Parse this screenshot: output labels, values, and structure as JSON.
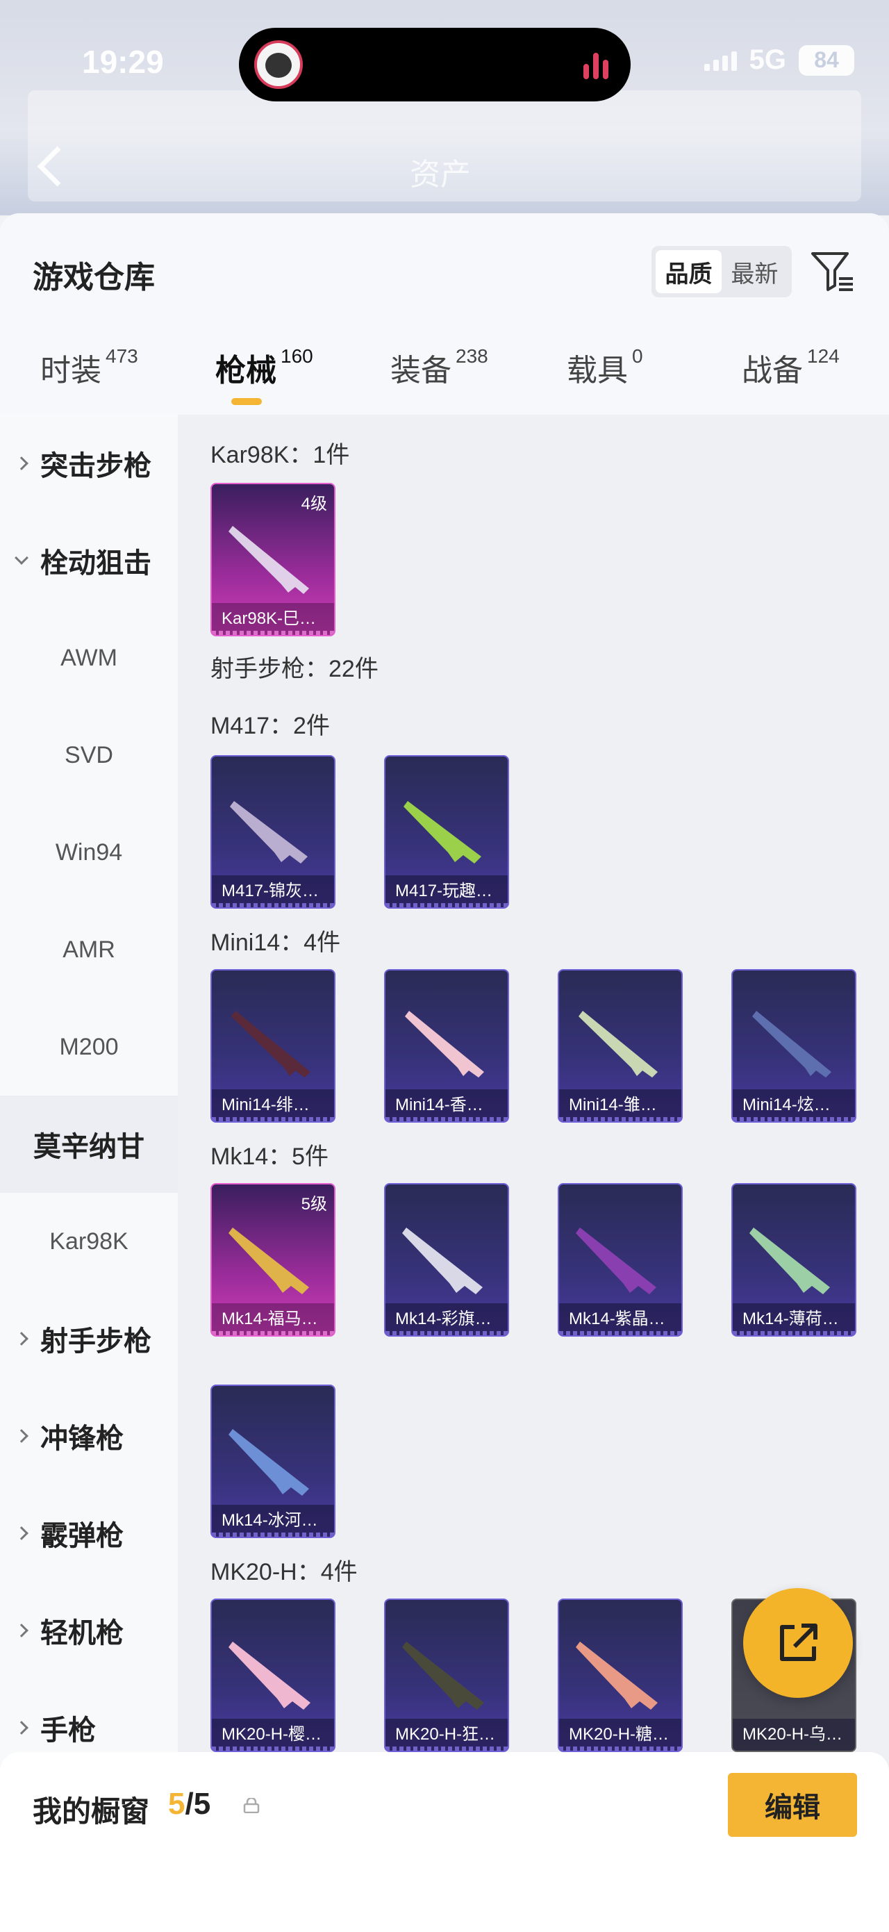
{
  "status_bar": {
    "time": "19:29",
    "network": "5G",
    "battery": "84"
  },
  "background_header": {
    "title": "资产"
  },
  "sheet": {
    "title": "游戏仓库",
    "sort": {
      "quality": "品质",
      "latest": "最新"
    },
    "tabs": [
      {
        "label": "时装",
        "count": "473"
      },
      {
        "label": "枪械",
        "count": "160"
      },
      {
        "label": "装备",
        "count": "238"
      },
      {
        "label": "载具",
        "count": "0"
      },
      {
        "label": "战备",
        "count": "124"
      }
    ]
  },
  "sidebar": {
    "items": [
      {
        "label": "突击步枪"
      },
      {
        "label": "栓动狙击"
      },
      {
        "label": "AWM"
      },
      {
        "label": "SVD"
      },
      {
        "label": "Win94"
      },
      {
        "label": "AMR"
      },
      {
        "label": "M200"
      },
      {
        "label": "莫辛纳甘"
      },
      {
        "label": "Kar98K"
      },
      {
        "label": "射手步枪"
      },
      {
        "label": "冲锋枪"
      },
      {
        "label": "霰弹枪"
      },
      {
        "label": "轻机枪"
      },
      {
        "label": "手枪"
      }
    ]
  },
  "content": {
    "groups": [
      {
        "title": "Kar98K：1件",
        "cards": [
          {
            "name": "Kar98K-巳…",
            "level": "4级"
          }
        ]
      },
      {
        "title": "射手步枪：22件"
      },
      {
        "title": "M417：2件",
        "cards": [
          {
            "name": "M417-锦灰…"
          },
          {
            "name": "M417-玩趣…"
          }
        ]
      },
      {
        "title": "Mini14：4件",
        "cards": [
          {
            "name": "Mini14-绯…"
          },
          {
            "name": "Mini14-香…"
          },
          {
            "name": "Mini14-雏…"
          },
          {
            "name": "Mini14-炫…"
          }
        ]
      },
      {
        "title": "Mk14：5件",
        "cards": [
          {
            "name": "Mk14-福马…",
            "level": "5级"
          },
          {
            "name": "Mk14-彩旗…"
          },
          {
            "name": "Mk14-紫晶…"
          },
          {
            "name": "Mk14-薄荷…"
          },
          {
            "name": "Mk14-冰河…"
          }
        ]
      },
      {
        "title": "MK20-H：4件",
        "cards": [
          {
            "name": "MK20-H-樱…"
          },
          {
            "name": "MK20-H-狂…"
          },
          {
            "name": "MK20-H-糖…"
          },
          {
            "name": "MK20-H-乌…"
          }
        ]
      }
    ]
  },
  "bottom_bar": {
    "label": "我的橱窗",
    "current": "5",
    "separator": "/",
    "total": "5",
    "edit": "编辑"
  },
  "colors": {
    "accent": "#f3b533",
    "card_blue": "#37327a",
    "card_pink": "#d03eb8"
  }
}
